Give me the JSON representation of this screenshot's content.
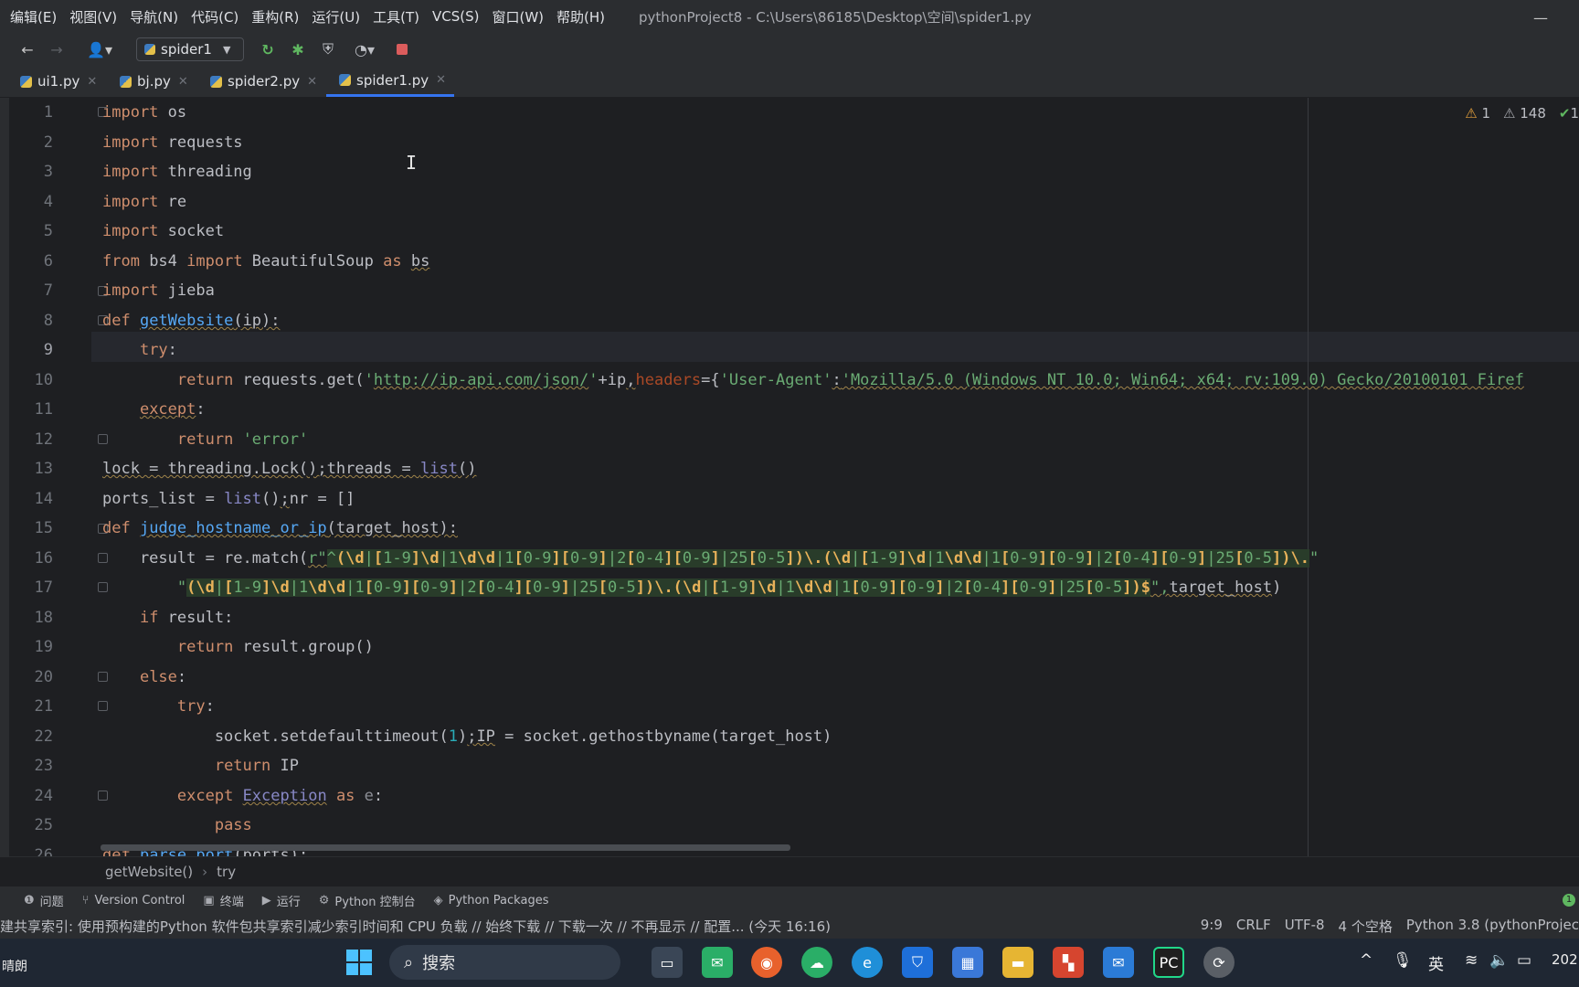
{
  "menu": [
    "编辑(E)",
    "视图(V)",
    "导航(N)",
    "代码(C)",
    "重构(R)",
    "运行(U)",
    "工具(T)",
    "VCS(S)",
    "窗口(W)",
    "帮助(H)"
  ],
  "window_title": "pythonProject8 - C:\\Users\\86185\\Desktop\\空间\\spider1.py",
  "run_config": "spider1",
  "tabs": [
    "ui1.py",
    "bj.py",
    "spider2.py",
    "spider1.py"
  ],
  "active_tab": "spider1.py",
  "inspections": {
    "errors": "1",
    "warnings": "148",
    "ok": "1"
  },
  "line_numbers": [
    "1",
    "2",
    "3",
    "4",
    "5",
    "6",
    "7",
    "8",
    "9",
    "10",
    "11",
    "12",
    "13",
    "14",
    "15",
    "16",
    "17",
    "18",
    "19",
    "20",
    "21",
    "22",
    "23",
    "24",
    "25",
    "26"
  ],
  "current_line": "9",
  "breadcrumb": {
    "func": "getWebsite()",
    "block": "try"
  },
  "tool_windows": [
    "问题",
    "Version Control",
    "终端",
    "运行",
    "Python 控制台",
    "Python Packages"
  ],
  "status": {
    "message": "建共享索引: 使用预构建的Python 软件包共享索引减少索引时间和 CPU 负载 // 始终下载 // 下载一次 // 不再显示 // 配置... (今天 16:16)",
    "position": "9:9",
    "line_sep": "CRLF",
    "encoding": "UTF-8",
    "indent": "4 个空格",
    "interpreter": "Python 3.8 (pythonProjec"
  },
  "taskbar": {
    "search": "搜索",
    "weather": "晴朗",
    "ime": "英",
    "clock": "202"
  },
  "colors": {
    "keyword": "#cf8e6d",
    "string": "#6aab73",
    "function": "#56a8f5",
    "number": "#2aacb8",
    "builtin": "#8888c6",
    "accent": "#3574f0"
  }
}
